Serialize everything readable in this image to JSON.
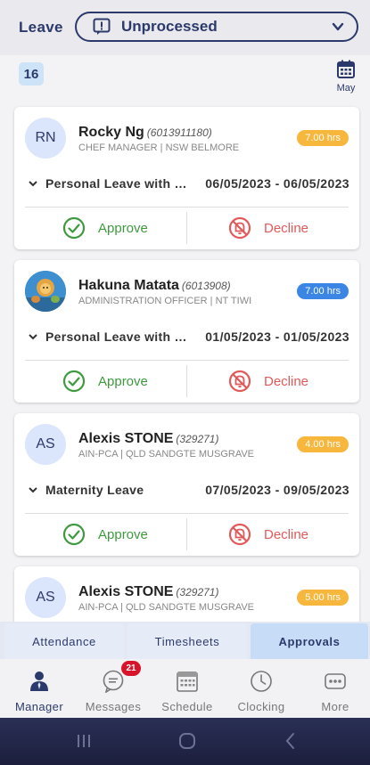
{
  "header": {
    "title": "Leave",
    "status_filter": "Unprocessed"
  },
  "subbar": {
    "pending_count": "16",
    "calendar_label": "May"
  },
  "cards": [
    {
      "initials": "RN",
      "name": "Rocky Ng",
      "emp_id": "(6013911180)",
      "role": "CHEF MANAGER | NSW BELMORE",
      "hours": "7.00 hrs",
      "hours_color": "#f6b73c",
      "leave_type": "Personal Leave with Medical Certificate",
      "dates": "06/05/2023 - 06/05/2023",
      "approve": "Approve",
      "decline": "Decline"
    },
    {
      "initials": "",
      "name": "Hakuna Matata",
      "emp_id": "(6013908)",
      "role": "ADMINISTRATION OFFICER | NT TIWI",
      "hours": "7.00 hrs",
      "hours_color": "#3b86e4",
      "leave_type": "Personal Leave with Medical Certificate",
      "dates": "01/05/2023 - 01/05/2023",
      "approve": "Approve",
      "decline": "Decline"
    },
    {
      "initials": "AS",
      "name": "Alexis STONE",
      "emp_id": "(329271)",
      "role": "AIN-PCA | QLD SANDGTE MUSGRAVE",
      "hours": "4.00 hrs",
      "hours_color": "#f6b73c",
      "leave_type": "Maternity Leave",
      "dates": "07/05/2023 - 09/05/2023",
      "approve": "Approve",
      "decline": "Decline"
    },
    {
      "initials": "AS",
      "name": "Alexis STONE",
      "emp_id": "(329271)",
      "role": "AIN-PCA | QLD SANDGTE MUSGRAVE",
      "hours": "5.00 hrs",
      "hours_color": "#f6b73c"
    }
  ],
  "tabs": [
    "Attendance",
    "Timesheets",
    "Approvals"
  ],
  "nav": {
    "manager": "Manager",
    "messages": "Messages",
    "messages_badge": "21",
    "schedule": "Schedule",
    "clocking": "Clocking",
    "more": "More"
  },
  "colors": {
    "primary": "#2c3a6b",
    "approve": "#3e9a3e",
    "decline": "#e15a5a"
  }
}
